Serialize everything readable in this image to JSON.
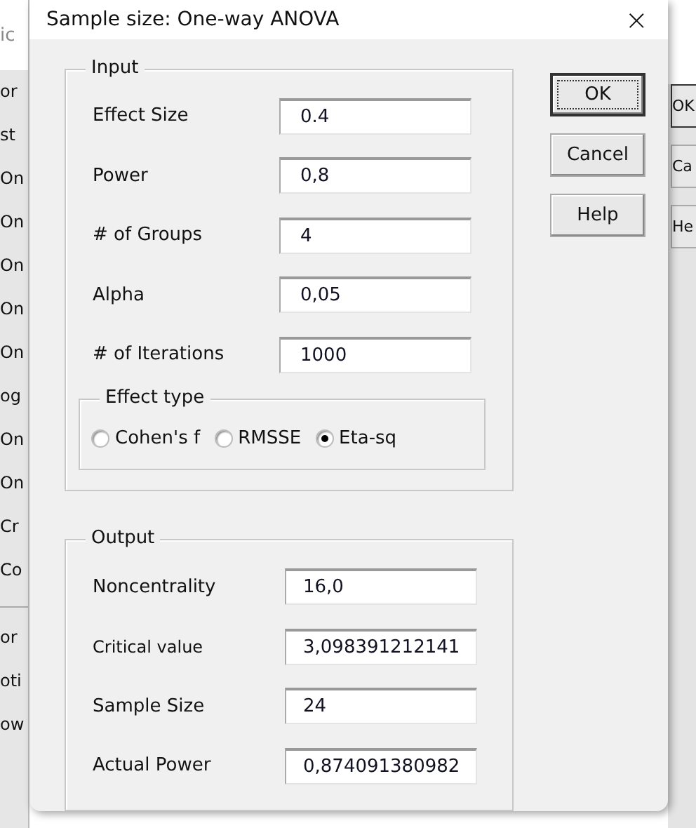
{
  "background_window": {
    "title": "ic",
    "list_items": [
      {
        "label": "or"
      },
      {
        "label": "st"
      },
      {
        "label": "On"
      },
      {
        "label": "On"
      },
      {
        "label": "On"
      },
      {
        "label": "On"
      },
      {
        "label": "On"
      },
      {
        "label": "og"
      },
      {
        "label": "On"
      },
      {
        "label": "On"
      },
      {
        "label": "Cr"
      },
      {
        "label": "Co"
      }
    ],
    "lower_items": [
      {
        "label": "or"
      },
      {
        "label": "oti"
      },
      {
        "label": "ow"
      }
    ],
    "buttons": [
      "OK",
      "Ca",
      "He"
    ]
  },
  "window": {
    "title": "Sample size: One-way ANOVA",
    "close": "×"
  },
  "input": {
    "title": "Input",
    "fields": [
      {
        "label": "Effect Size",
        "value": "0.4"
      },
      {
        "label": "Power",
        "value": "0,8"
      },
      {
        "label": "# of Groups",
        "value": "4"
      },
      {
        "label": "Alpha",
        "value": "0,05"
      },
      {
        "label": "# of Iterations",
        "value": "1000"
      }
    ],
    "effect_type": {
      "title": "Effect type",
      "options": [
        {
          "label": "Cohen's f",
          "selected": false
        },
        {
          "label": "RMSSE",
          "selected": false
        },
        {
          "label": "Eta-sq",
          "selected": true
        }
      ]
    }
  },
  "output": {
    "title": "Output",
    "fields": [
      {
        "label": "Noncentrality",
        "value": "16,0"
      },
      {
        "label": "Critical value",
        "value": "3,098391212141"
      },
      {
        "label": "Sample Size",
        "value": "24"
      },
      {
        "label": "Actual Power",
        "value": "0,874091380982"
      }
    ]
  },
  "buttons": [
    {
      "label": "OK",
      "default": true
    },
    {
      "label": "Cancel",
      "default": false
    },
    {
      "label": "Help",
      "default": false
    }
  ]
}
